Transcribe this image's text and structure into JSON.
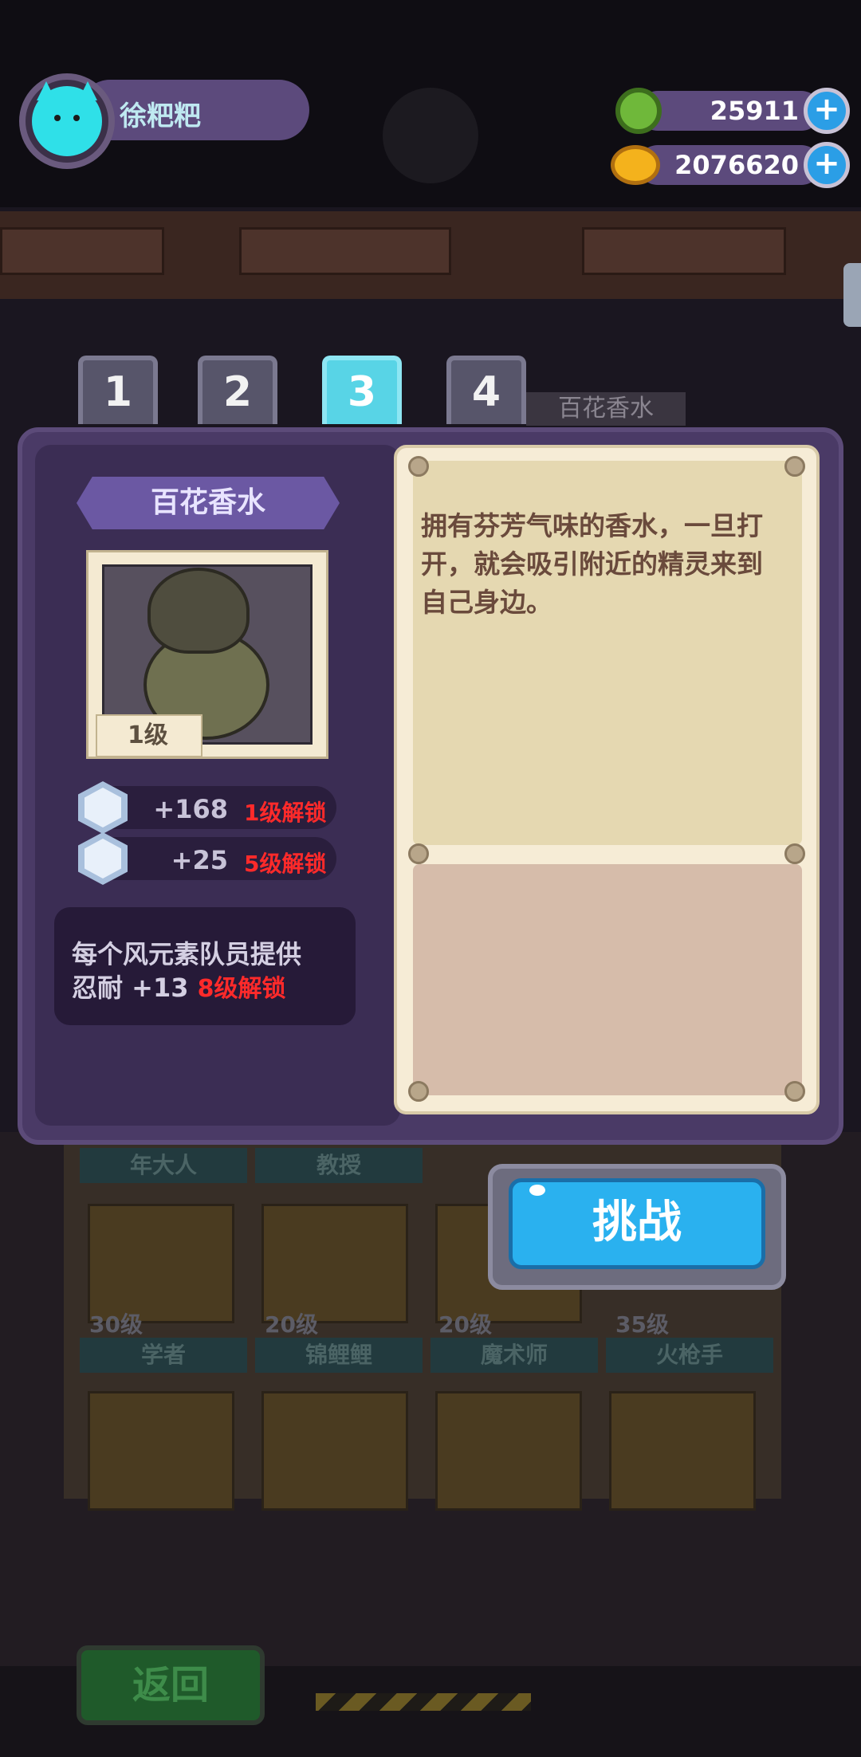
{
  "player": {
    "name": "徐粑粑"
  },
  "currency": {
    "gems": "25911",
    "coins": "2076620",
    "plus": "+"
  },
  "tabs": [
    "1",
    "2",
    "3",
    "4"
  ],
  "background_label": "百花香水",
  "item": {
    "name": "百花香水",
    "level": "1级",
    "stats": [
      {
        "icon": "heart-icon",
        "value": "+168",
        "unlock": "1级解锁"
      },
      {
        "icon": "shield-icon",
        "value": "+25",
        "unlock": "5级解锁"
      }
    ],
    "bonus_line1": "每个风元素队员提供",
    "bonus_line2": "忍耐 +13",
    "bonus_unlock": "8级解锁",
    "description": "拥有芬芳气味的香水，一旦打开，就会吸引附近的精灵来到自己身边。"
  },
  "challenge_label": "挑战",
  "back_label": "返回",
  "dim_grid": {
    "row1_names": [
      "年大人",
      "教授",
      "",
      ""
    ],
    "row2_levels": [
      "30级",
      "20级",
      "20级",
      "35级"
    ],
    "row2_names": [
      "学者",
      "锦鲤鲤",
      "魔术师",
      "火枪手"
    ]
  },
  "colors": {
    "panel": "#4a3a66",
    "accent_tab": "#58d4e6",
    "challenge": "#2ab1ef",
    "lock_red": "#ff2a2a"
  }
}
